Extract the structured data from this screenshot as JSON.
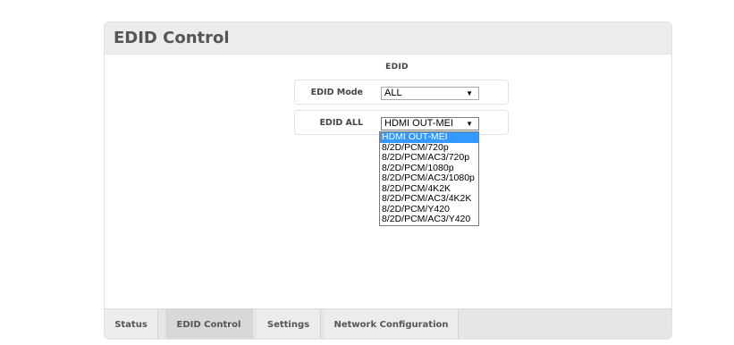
{
  "panel": {
    "title": "EDID Control"
  },
  "section": {
    "label": "EDID"
  },
  "edid_mode": {
    "label": "EDID Mode",
    "value": "ALL"
  },
  "edid_all": {
    "label": "EDID ALL",
    "value": "HDMI OUT-MEI",
    "options": [
      "HDMI OUT-MEI",
      "8/2D/PCM/720p",
      "8/2D/PCM/AC3/720p",
      "8/2D/PCM/1080p",
      "8/2D/PCM/AC3/1080p",
      "8/2D/PCM/4K2K",
      "8/2D/PCM/AC3/4K2K",
      "8/2D/PCM/Y420",
      "8/2D/PCM/AC3/Y420"
    ],
    "selected_index": 0
  },
  "tabs": [
    {
      "label": "Status"
    },
    {
      "label": "EDID Control"
    },
    {
      "label": "Settings"
    },
    {
      "label": "Network Configuration"
    }
  ],
  "active_tab": "EDID Control",
  "colors": {
    "highlight": "#3399ff",
    "header_bg": "#ececec",
    "tab_active_bg": "#d8d8d8"
  },
  "icons": {
    "dropdown_arrow": "triangle-down-icon"
  }
}
